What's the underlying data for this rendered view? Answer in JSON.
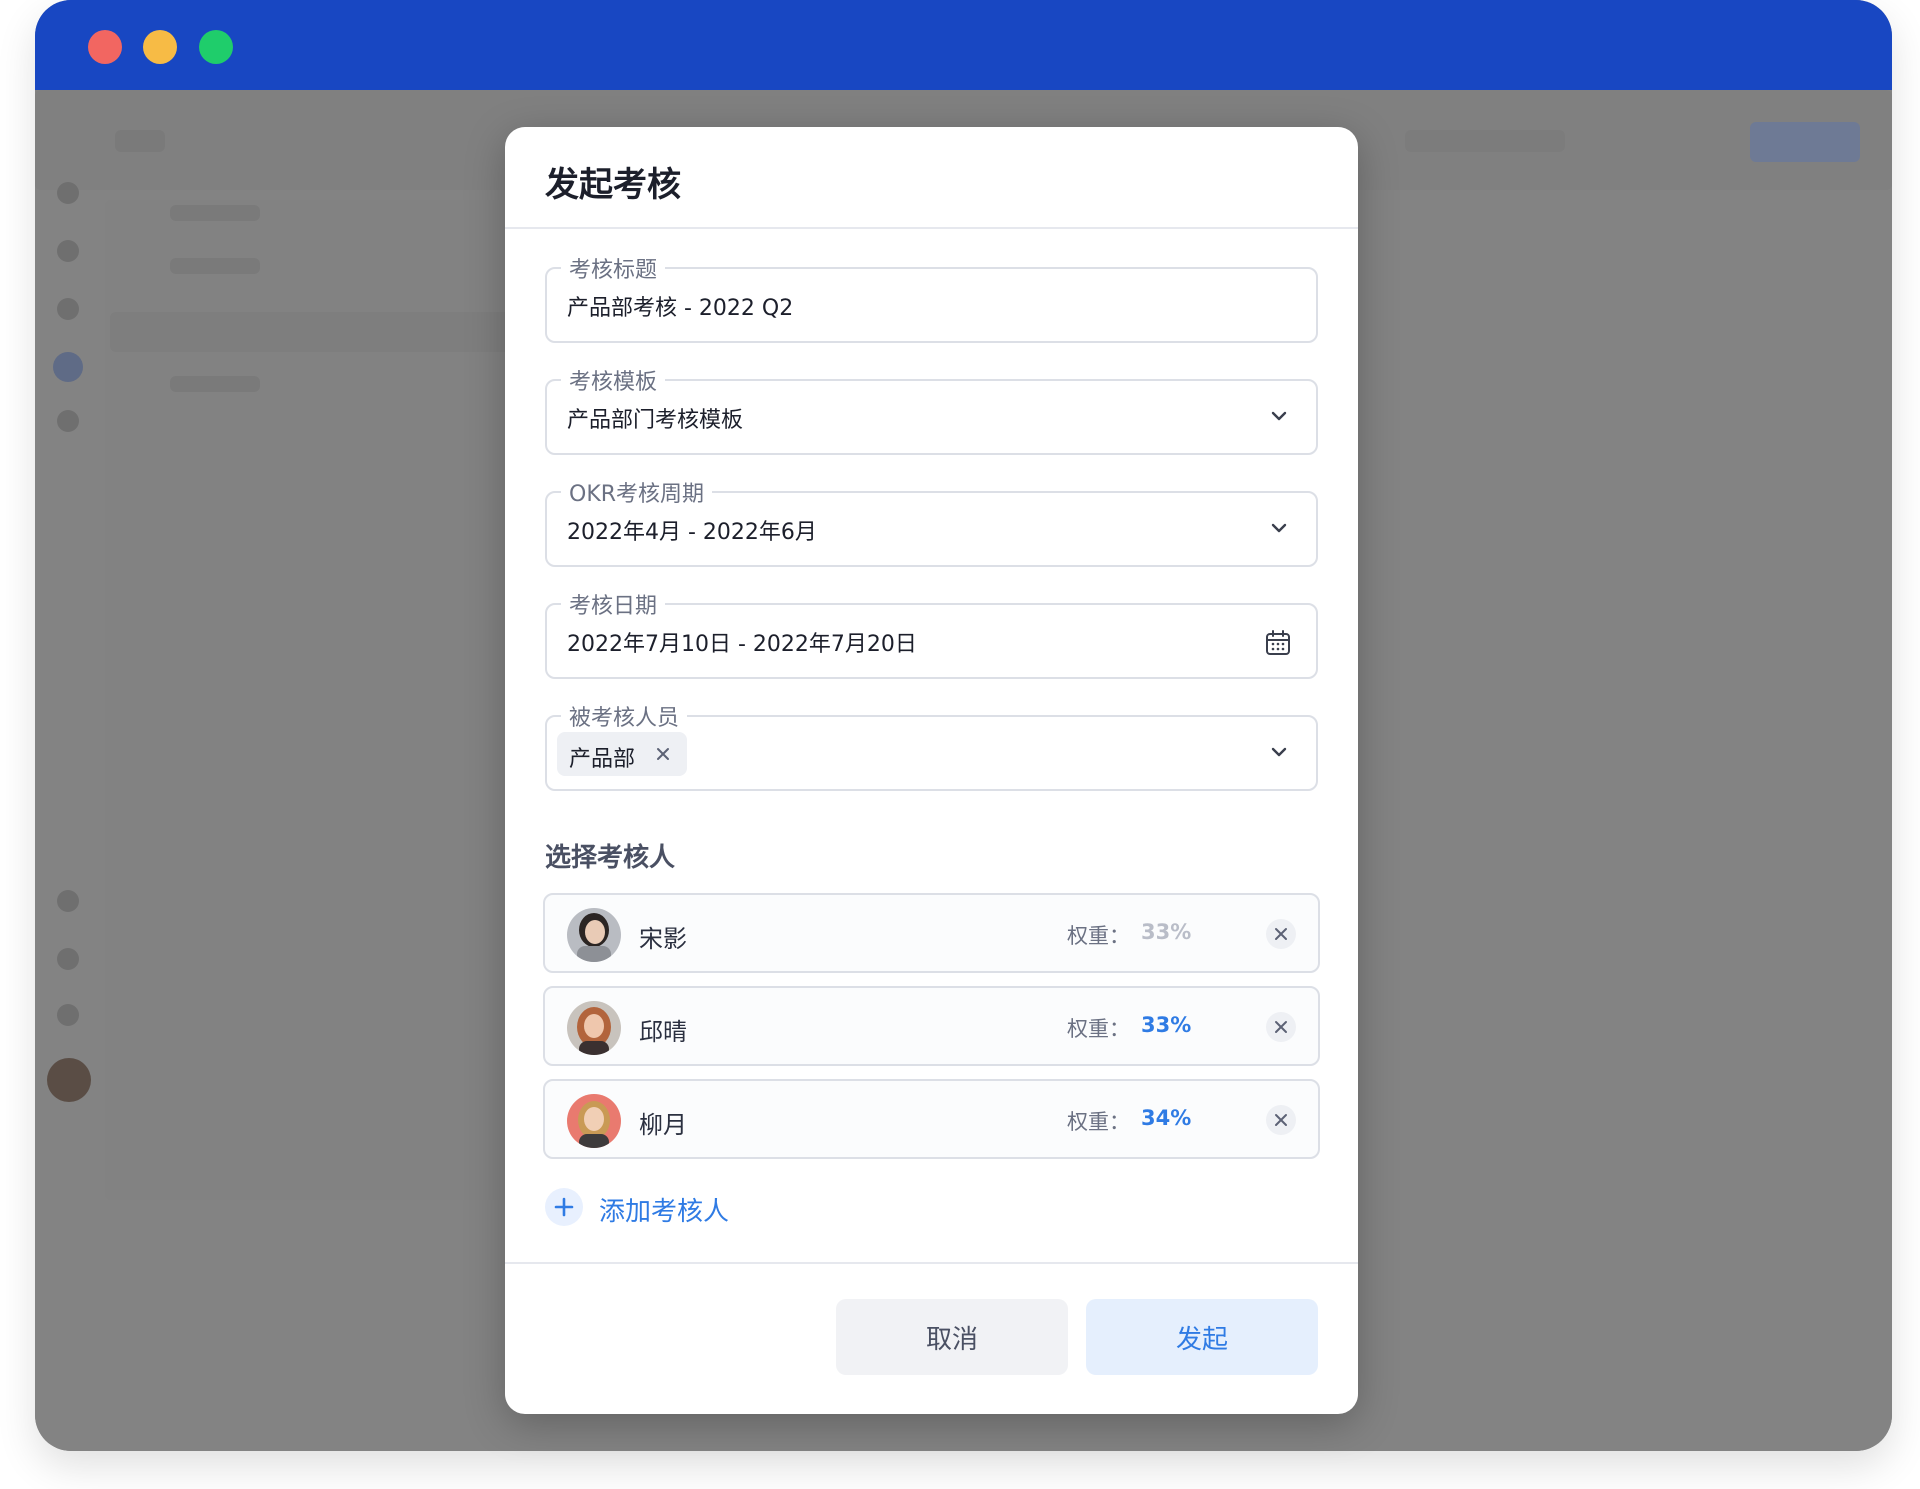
{
  "window": {
    "accent_color": "#1847c2",
    "traffic_lights": [
      "#f26661",
      "#f7bb45",
      "#1fcd6b"
    ]
  },
  "modal": {
    "title": "发起考核",
    "fields": {
      "title": {
        "label": "考核标题",
        "value": "产品部考核 - 2022 Q2"
      },
      "template": {
        "label": "考核模板",
        "value": "产品部门考核模板",
        "icon": "chevron-down-icon"
      },
      "okr_period": {
        "label": "OKR考核周期",
        "value": "2022年4月 - 2022年6月",
        "icon": "chevron-down-icon"
      },
      "review_date": {
        "label": "考核日期",
        "value": "2022年7月10日 - 2022年7月20日",
        "icon": "calendar-icon"
      },
      "reviewees": {
        "label": "被考核人员",
        "tags": [
          "产品部"
        ],
        "icon": "chevron-down-icon"
      }
    },
    "reviewers_section_title": "选择考核人",
    "weight_label": "权重：",
    "reviewers": [
      {
        "name": "宋影",
        "weight": "33%",
        "weight_color": "#b9bdc8"
      },
      {
        "name": "邱晴",
        "weight": "33%",
        "weight_color": "#2f7be4"
      },
      {
        "name": "柳月",
        "weight": "34%",
        "weight_color": "#2f7be4"
      }
    ],
    "add_reviewer_label": "添加考核人",
    "buttons": {
      "cancel": "取消",
      "submit": "发起"
    }
  }
}
